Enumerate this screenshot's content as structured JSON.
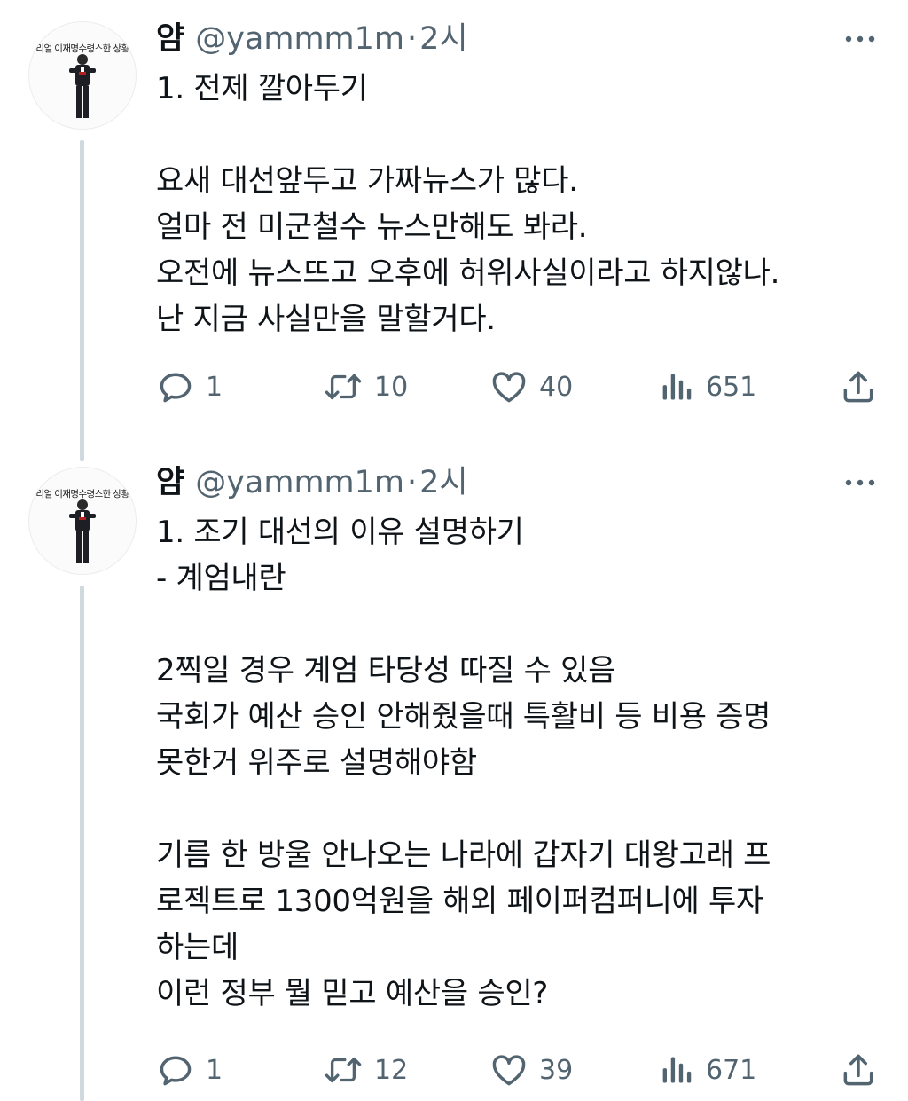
{
  "tweets": [
    {
      "avatar_caption": "리얼 이재명수령스한 상황",
      "name": "얌",
      "handle": "@yammm1m",
      "separator": "·",
      "time": "2시",
      "lines": [
        "1. 전제 깔아두기",
        "",
        "요새 대선앞두고 가짜뉴스가 많다.",
        "얼마 전 미군철수 뉴스만해도 봐라.",
        "오전에 뉴스뜨고 오후에 허위사실이라고 하지않나.",
        "난 지금 사실만을 말할거다."
      ],
      "replies": "1",
      "retweets": "10",
      "likes": "40",
      "views": "651"
    },
    {
      "avatar_caption": "리얼 이재명수령스한 상황",
      "name": "얌",
      "handle": "@yammm1m",
      "separator": "·",
      "time": "2시",
      "lines": [
        "1. 조기 대선의 이유 설명하기",
        "- 계엄내란",
        "",
        "2찍일 경우 계엄 타당성 따질 수 있음",
        "국회가 예산 승인 안해줬을때 특활비 등 비용 증명",
        "못한거 위주로 설명해야함",
        "",
        "기름 한 방울 안나오는 나라에 갑자기 대왕고래 프",
        "로젝트로 1300억원을 해외 페이퍼컴퍼니에 투자",
        "하는데",
        "이런 정부 뭘 믿고 예산을 승인?"
      ],
      "replies": "1",
      "retweets": "12",
      "likes": "39",
      "views": "671"
    }
  ],
  "icons": {
    "more": "more-dots-icon",
    "reply": "reply-icon",
    "retweet": "retweet-icon",
    "like": "heart-icon",
    "views": "views-icon",
    "share": "share-icon"
  },
  "colors": {
    "text": "#0f1419",
    "secondary": "#536471",
    "thread_line": "#cfd9de"
  }
}
